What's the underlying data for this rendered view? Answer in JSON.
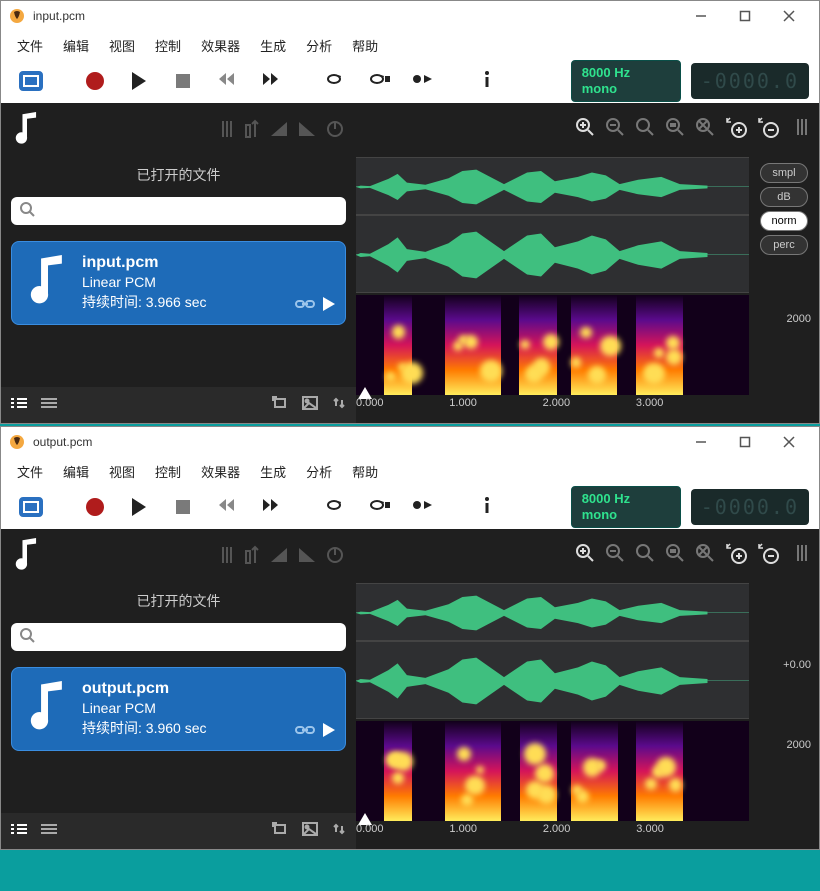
{
  "windows": [
    {
      "title": "input.pcm",
      "menu": [
        "文件",
        "编辑",
        "视图",
        "控制",
        "效果器",
        "生成",
        "分析",
        "帮助"
      ],
      "lcd": {
        "rate": "8000 Hz",
        "channels": "mono",
        "counter": "-0000.0"
      },
      "sidebar": {
        "section_label": "已打开的文件",
        "search_placeholder": "",
        "file": {
          "name": "input.pcm",
          "format": "Linear PCM",
          "duration_label": "持续时间: 3.966 sec"
        }
      },
      "scale_pills": [
        "smpl",
        "dB",
        "norm",
        "perc"
      ],
      "scale_active": "norm",
      "freq_label": "2000",
      "amp_label": "",
      "time_ticks": [
        "0.000",
        "1.000",
        "2.000",
        "3.000"
      ]
    },
    {
      "title": "output.pcm",
      "menu": [
        "文件",
        "编辑",
        "视图",
        "控制",
        "效果器",
        "生成",
        "分析",
        "帮助"
      ],
      "lcd": {
        "rate": "8000 Hz",
        "channels": "mono",
        "counter": "-0000.0"
      },
      "sidebar": {
        "section_label": "已打开的文件",
        "search_placeholder": "",
        "file": {
          "name": "output.pcm",
          "format": "Linear PCM",
          "duration_label": "持续时间: 3.960 sec"
        }
      },
      "scale_pills": [],
      "scale_active": "",
      "freq_label": "2000",
      "amp_label": "+0.00",
      "time_ticks": [
        "0.000",
        "1.000",
        "2.000",
        "3.000"
      ]
    }
  ],
  "chart_data": [
    {
      "type": "line",
      "title": "input.pcm waveform + spectrogram",
      "x_unit": "seconds",
      "xlim": [
        0,
        3.966
      ],
      "waveform_envelope": [
        {
          "t": 0.05,
          "a": 0.05
        },
        {
          "t": 0.15,
          "a": 0.03
        },
        {
          "t": 0.35,
          "a": 0.28
        },
        {
          "t": 0.45,
          "a": 0.45
        },
        {
          "t": 0.55,
          "a": 0.15
        },
        {
          "t": 0.75,
          "a": 0.08
        },
        {
          "t": 1.0,
          "a": 0.3
        },
        {
          "t": 1.15,
          "a": 0.55
        },
        {
          "t": 1.3,
          "a": 0.6
        },
        {
          "t": 1.45,
          "a": 0.35
        },
        {
          "t": 1.6,
          "a": 0.1
        },
        {
          "t": 1.85,
          "a": 0.5
        },
        {
          "t": 2.0,
          "a": 0.55
        },
        {
          "t": 2.15,
          "a": 0.2
        },
        {
          "t": 2.4,
          "a": 0.35
        },
        {
          "t": 2.55,
          "a": 0.5
        },
        {
          "t": 2.7,
          "a": 0.4
        },
        {
          "t": 2.85,
          "a": 0.1
        },
        {
          "t": 3.05,
          "a": 0.25
        },
        {
          "t": 3.3,
          "a": 0.35
        },
        {
          "t": 3.5,
          "a": 0.1
        },
        {
          "t": 3.8,
          "a": 0.05
        }
      ],
      "spectrogram": {
        "ylabel": "Hz",
        "ylim": [
          0,
          4000
        ],
        "ytick": 2000,
        "hot_regions": [
          {
            "t0": 0.3,
            "t1": 0.6
          },
          {
            "t0": 0.95,
            "t1": 1.55
          },
          {
            "t0": 1.75,
            "t1": 2.15
          },
          {
            "t0": 2.3,
            "t1": 2.8
          },
          {
            "t0": 3.0,
            "t1": 3.5
          }
        ]
      }
    },
    {
      "type": "line",
      "title": "output.pcm waveform + spectrogram",
      "x_unit": "seconds",
      "xlim": [
        0,
        3.96
      ],
      "waveform_envelope": [
        {
          "t": 0.05,
          "a": 0.05
        },
        {
          "t": 0.15,
          "a": 0.03
        },
        {
          "t": 0.35,
          "a": 0.28
        },
        {
          "t": 0.45,
          "a": 0.45
        },
        {
          "t": 0.55,
          "a": 0.15
        },
        {
          "t": 0.75,
          "a": 0.08
        },
        {
          "t": 1.0,
          "a": 0.3
        },
        {
          "t": 1.15,
          "a": 0.55
        },
        {
          "t": 1.3,
          "a": 0.6
        },
        {
          "t": 1.45,
          "a": 0.35
        },
        {
          "t": 1.6,
          "a": 0.1
        },
        {
          "t": 1.85,
          "a": 0.5
        },
        {
          "t": 2.0,
          "a": 0.55
        },
        {
          "t": 2.15,
          "a": 0.2
        },
        {
          "t": 2.4,
          "a": 0.35
        },
        {
          "t": 2.55,
          "a": 0.5
        },
        {
          "t": 2.7,
          "a": 0.4
        },
        {
          "t": 2.85,
          "a": 0.1
        },
        {
          "t": 3.05,
          "a": 0.25
        },
        {
          "t": 3.3,
          "a": 0.35
        },
        {
          "t": 3.5,
          "a": 0.1
        },
        {
          "t": 3.8,
          "a": 0.05
        }
      ],
      "spectrogram": {
        "ylabel": "Hz",
        "ylim": [
          0,
          4000
        ],
        "ytick": 2000,
        "hot_regions": [
          {
            "t0": 0.3,
            "t1": 0.6
          },
          {
            "t0": 0.95,
            "t1": 1.55
          },
          {
            "t0": 1.75,
            "t1": 2.15
          },
          {
            "t0": 2.3,
            "t1": 2.8
          },
          {
            "t0": 3.0,
            "t1": 3.5
          }
        ]
      }
    }
  ]
}
